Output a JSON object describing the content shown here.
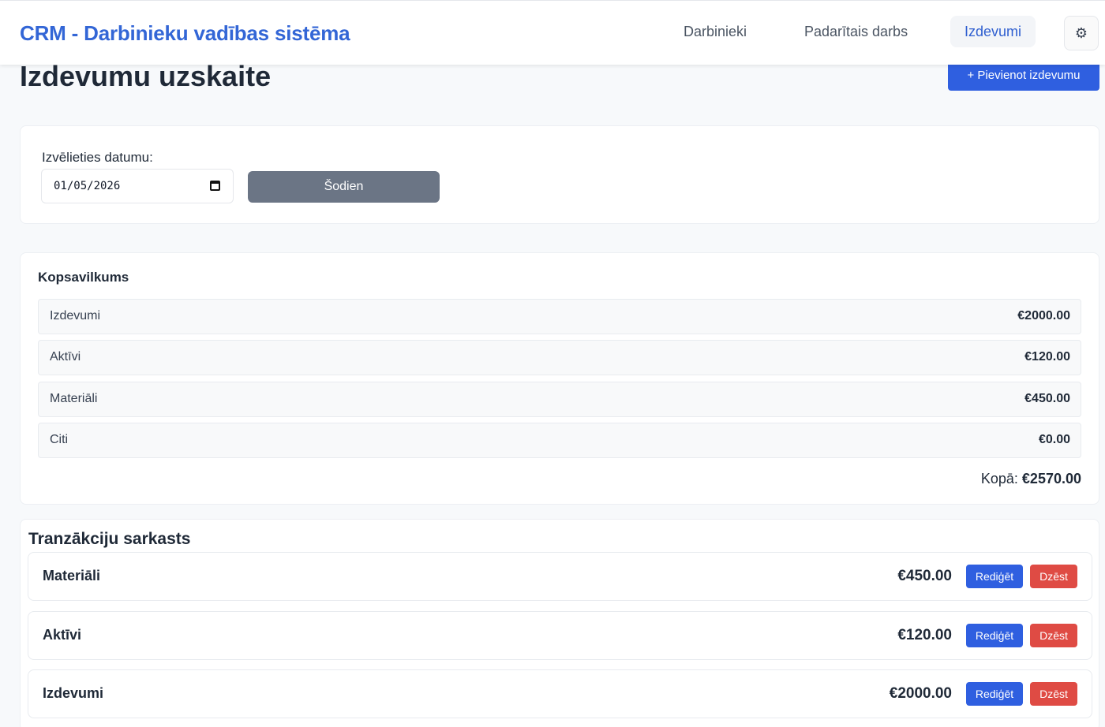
{
  "header": {
    "brand": "CRM - Darbinieku vadības sistēma",
    "nav": [
      {
        "label": "Darbinieki",
        "active": false
      },
      {
        "label": "Padarītais darbs",
        "active": false
      },
      {
        "label": "Izdevumi",
        "active": true
      }
    ],
    "settings_icon": "gear-icon"
  },
  "page": {
    "title": "Izdevumu uzskaite",
    "add_button": "+ Pievienot izdevumu"
  },
  "date_filter": {
    "label": "Izvēlieties datumu:",
    "value": "01/05/2026",
    "today_button": "Šodien"
  },
  "summary": {
    "title": "Kopsavilkums",
    "rows": [
      {
        "label": "Izdevumi",
        "value": "€2000.00"
      },
      {
        "label": "Aktīvi",
        "value": "€120.00"
      },
      {
        "label": "Materiāli",
        "value": "€450.00"
      },
      {
        "label": "Citi",
        "value": "€0.00"
      }
    ],
    "total_label": "Kopā:",
    "total_value": "€2570.00"
  },
  "transactions": {
    "title": "Tranzākciju sarkasts",
    "edit_label": "Rediģēt",
    "delete_label": "Dzēst",
    "items": [
      {
        "category": "Materiāli",
        "amount": "€450.00"
      },
      {
        "category": "Aktīvi",
        "amount": "€120.00"
      },
      {
        "category": "Izdevumi",
        "amount": "€2000.00"
      }
    ]
  },
  "colors": {
    "primary": "#2f5fe0",
    "danger": "#df4b44",
    "secondary": "#6b7585",
    "brand": "#3366d6"
  }
}
